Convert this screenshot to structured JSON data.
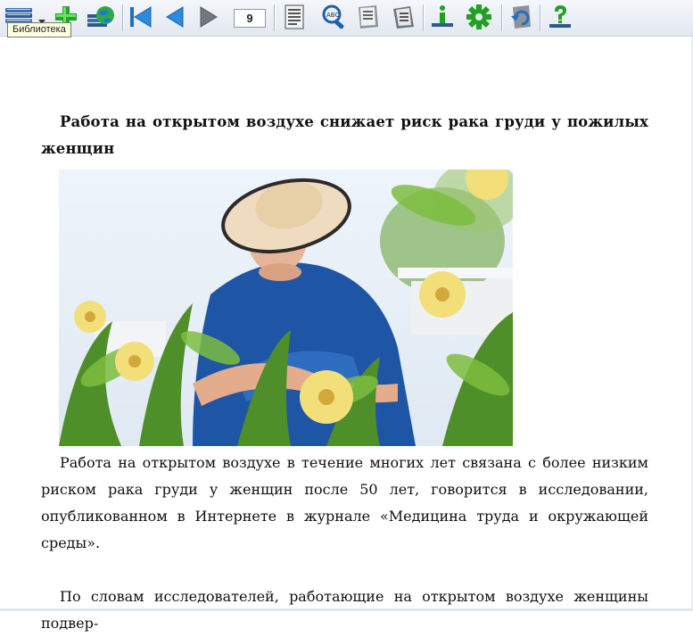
{
  "toolbar": {
    "page_number": "9",
    "tooltip": "Библиотека",
    "buttons": [
      {
        "name": "library",
        "icon": "books-icon"
      },
      {
        "name": "add",
        "icon": "plus-icon"
      },
      {
        "name": "network",
        "icon": "globe-icon"
      },
      {
        "name": "first-page",
        "icon": "first-page-icon"
      },
      {
        "name": "previous-page",
        "icon": "arrow-left-icon"
      },
      {
        "name": "next-page",
        "icon": "arrow-right-icon"
      },
      {
        "name": "table-of-contents",
        "icon": "document-list-icon"
      },
      {
        "name": "search",
        "icon": "magnifier-icon"
      },
      {
        "name": "page-view",
        "icon": "book-page-icon"
      },
      {
        "name": "pages-view",
        "icon": "book-pages-icon"
      },
      {
        "name": "info",
        "icon": "info-icon"
      },
      {
        "name": "settings",
        "icon": "gear-icon"
      },
      {
        "name": "rotate",
        "icon": "rotate-icon"
      },
      {
        "name": "help",
        "icon": "question-icon"
      }
    ]
  },
  "article": {
    "heading": "Работа на открытом воздухе снижает риск рака груди у пожилых женщин",
    "paragraph1": "Работа на открытом воздухе в течение многих лет связана с более низким риском рака груди у женщин после 50 лет, говорится в исследовании, опубликованном в Интернете в журнале «Медицина труда и окружающей среды».",
    "paragraph2": "По словам исследователей, работающие на открытом воздухе женщины подвер-"
  },
  "colors": {
    "toolbar_bg": "#e6ebf2",
    "icon_blue": "#2b7fd0",
    "icon_green": "#2aa52a",
    "tooltip_bg": "#ffffe1"
  }
}
